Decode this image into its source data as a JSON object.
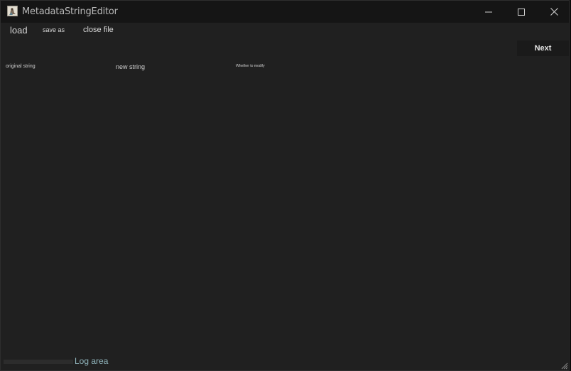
{
  "window": {
    "title": "MetadataStringEditor",
    "icon": "app-icon",
    "controls": {
      "minimize": "minimize-icon",
      "maximize": "maximize-icon",
      "close": "close-icon"
    }
  },
  "menu": {
    "load_label": "load",
    "save_as_label": "save as",
    "close_file_label": "close file"
  },
  "toolbar": {
    "next_label": "Next"
  },
  "table": {
    "columns": [
      "original string",
      "new string",
      "Whether to modify"
    ],
    "rows": []
  },
  "log": {
    "label": "Log area"
  },
  "colors": {
    "background": "#202020",
    "titlebar": "#151515",
    "text": "#d6d6d6",
    "log_label": "#8fb3ba"
  }
}
